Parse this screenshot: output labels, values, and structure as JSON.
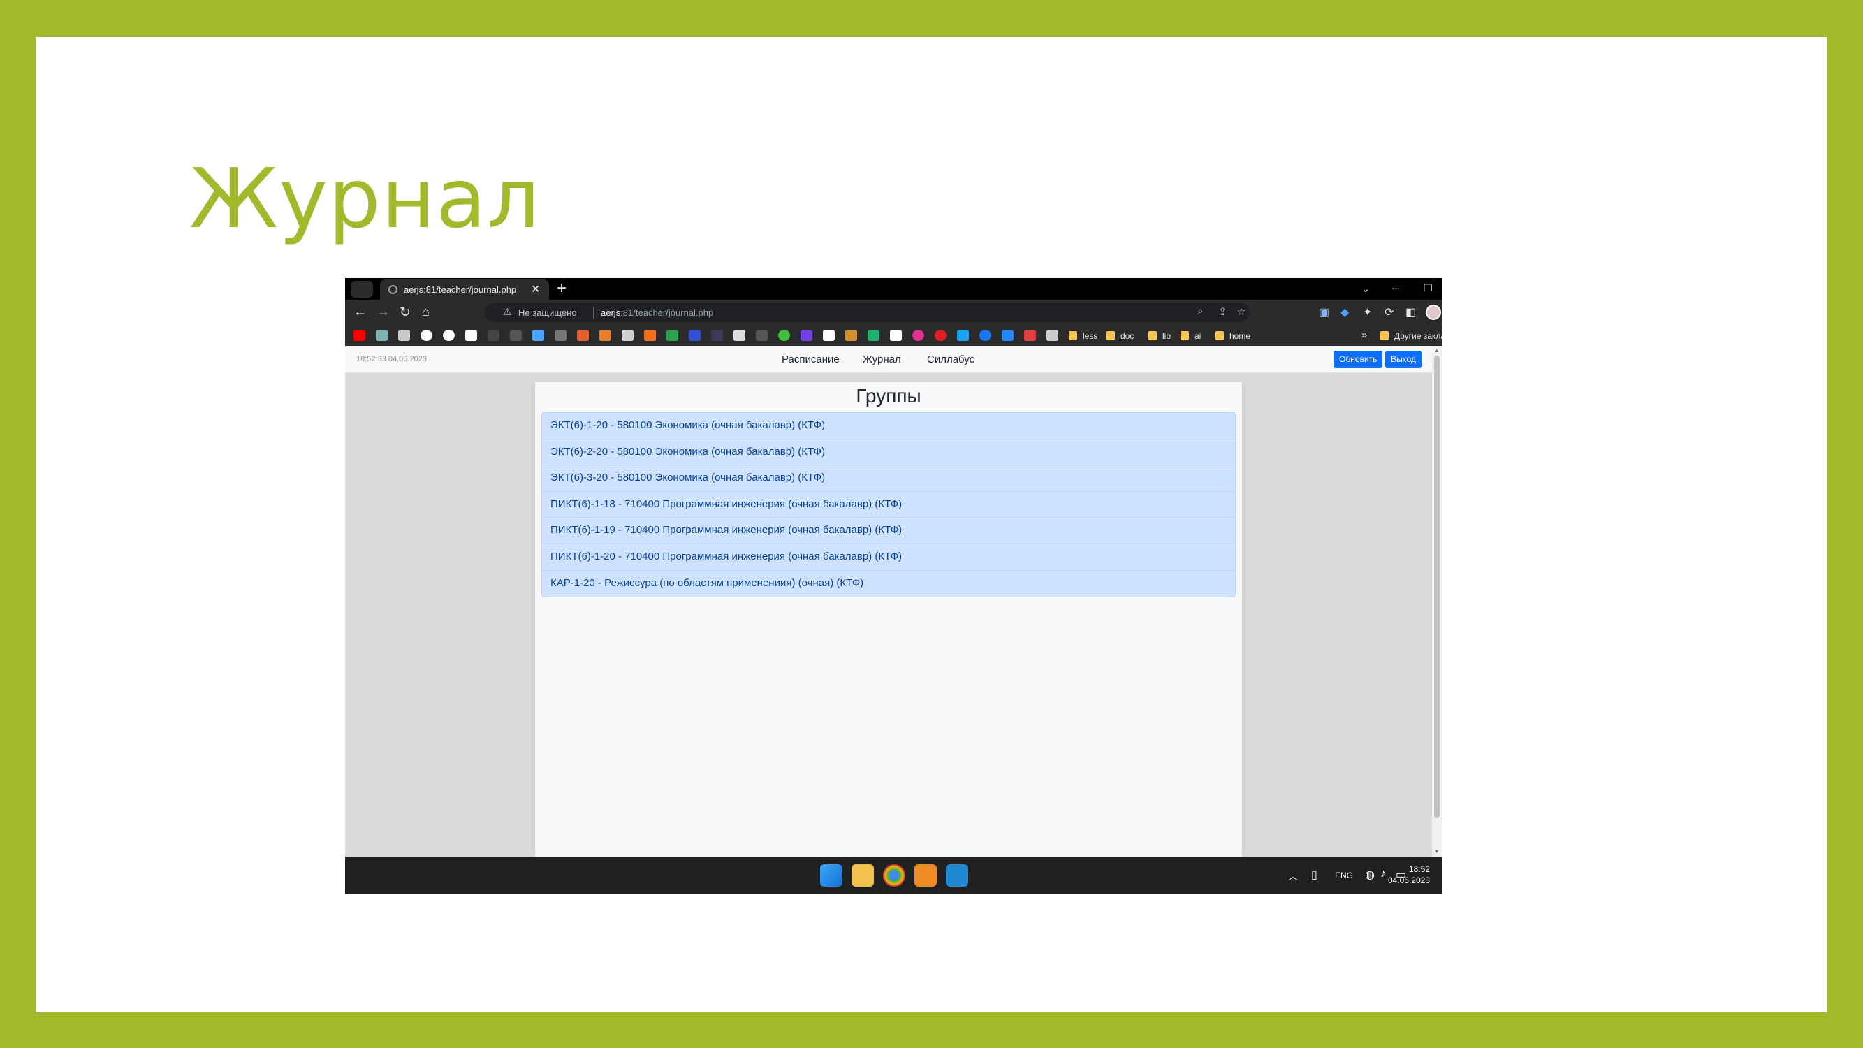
{
  "slide": {
    "title": "Журнал"
  },
  "browser": {
    "tab_title": "aerjs:81/teacher/journal.php",
    "security_text": "Не защищено",
    "url_host": "aerjs",
    "url_rest": ":81/teacher/journal.php",
    "bookmark_folders": [
      "less",
      "doc",
      "lib",
      "ai",
      "home"
    ],
    "other_bookmarks": "Другие закладки"
  },
  "page": {
    "datetime": "18:52:33 04.05.2023",
    "nav": [
      "Расписание",
      "Журнал",
      "Силлабус"
    ],
    "refresh_label": "Обновить",
    "logout_label": "Выход",
    "card_title": "Группы",
    "groups": [
      "ЭКТ(6)-1-20 - 580100 Экономика (очная бакалавр) (КТФ)",
      "ЭКТ(6)-2-20 - 580100 Экономика (очная бакалавр) (КТФ)",
      "ЭКТ(6)-3-20 - 580100 Экономика (очная бакалавр) (КТФ)",
      "ПИКТ(6)-1-18 - 710400 Программная инженерия (очная бакалавр) (КТФ)",
      "ПИКТ(6)-1-19 - 710400 Программная инженерия (очная бакалавр) (КТФ)",
      "ПИКТ(6)-1-20 - 710400 Программная инженерия (очная бакалавр) (КТФ)",
      "КАР-1-20 - Режиссура (по областям применениия) (очная) (КТФ)"
    ]
  },
  "taskbar": {
    "lang": "ENG",
    "time": "18:52",
    "date": "04.06.2023"
  }
}
